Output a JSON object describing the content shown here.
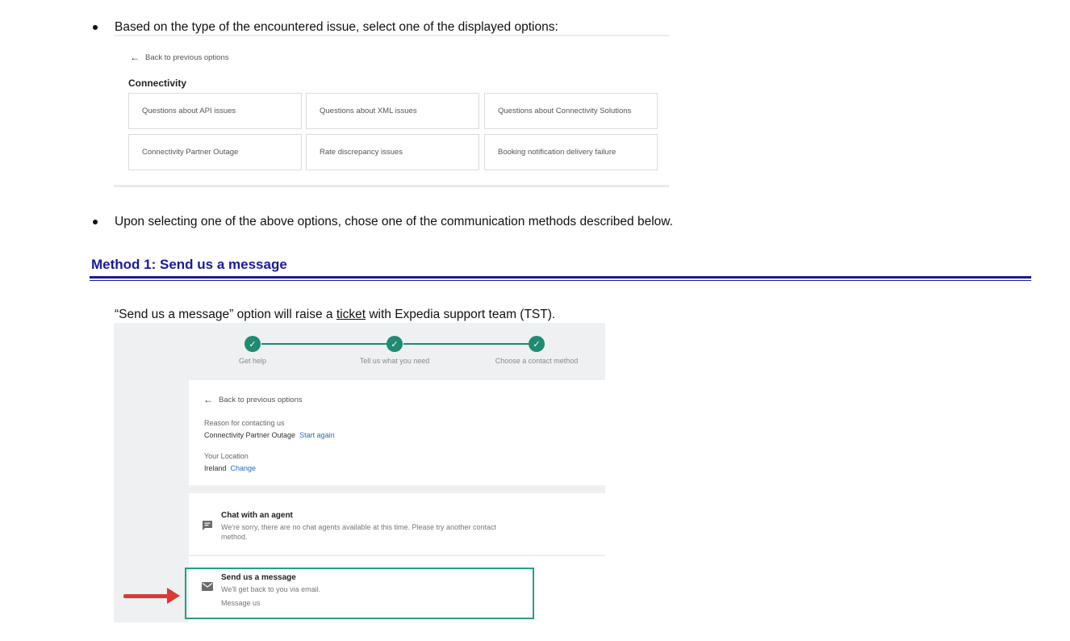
{
  "bullets": [
    "Based on the type of the encountered issue, select one of the displayed options:",
    "Upon selecting one of the above options, chose one of the communication methods described below."
  ],
  "options_panel": {
    "back_label": "Back to previous options",
    "category_title": "Connectivity",
    "options": [
      "Questions about API issues",
      "Questions about XML issues",
      "Questions about Connectivity Solutions",
      "Connectivity Partner Outage",
      "Rate discrepancy issues",
      "Booking notification delivery failure"
    ]
  },
  "method1": {
    "heading": "Method 1: Send us a message",
    "desc_before": "“Send us a message” option will raise a ",
    "desc_link": "ticket",
    "desc_after": " with Expedia support team (TST)."
  },
  "contact_panel": {
    "steps": [
      "Get help",
      "Tell us what you need",
      "Choose a contact method"
    ],
    "check_glyph": "✓",
    "back_label": "Back to previous options",
    "reason_label": "Reason for contacting us",
    "reason_value": "Connectivity Partner Outage",
    "start_again": "Start again",
    "location_label": "Your Location",
    "location_value": "Ireland",
    "change_label": "Change",
    "chat": {
      "title": "Chat with an agent",
      "desc": "We're sorry, there are no chat agents available at this time. Please try another contact method."
    },
    "message": {
      "title": "Send us a message",
      "desc": "We'll get back to you via email.",
      "action": "Message us"
    }
  },
  "colors": {
    "heading_blue": "#1a1a9c",
    "step_green": "#1f8b73",
    "highlight_green": "#2a9c86",
    "arrow_red": "#d93a32",
    "link_blue": "#2a6bbf"
  },
  "icons": {
    "back": "arrow-left-icon",
    "step": "check-icon",
    "chat": "chat-bubble-icon",
    "message": "envelope-icon"
  }
}
